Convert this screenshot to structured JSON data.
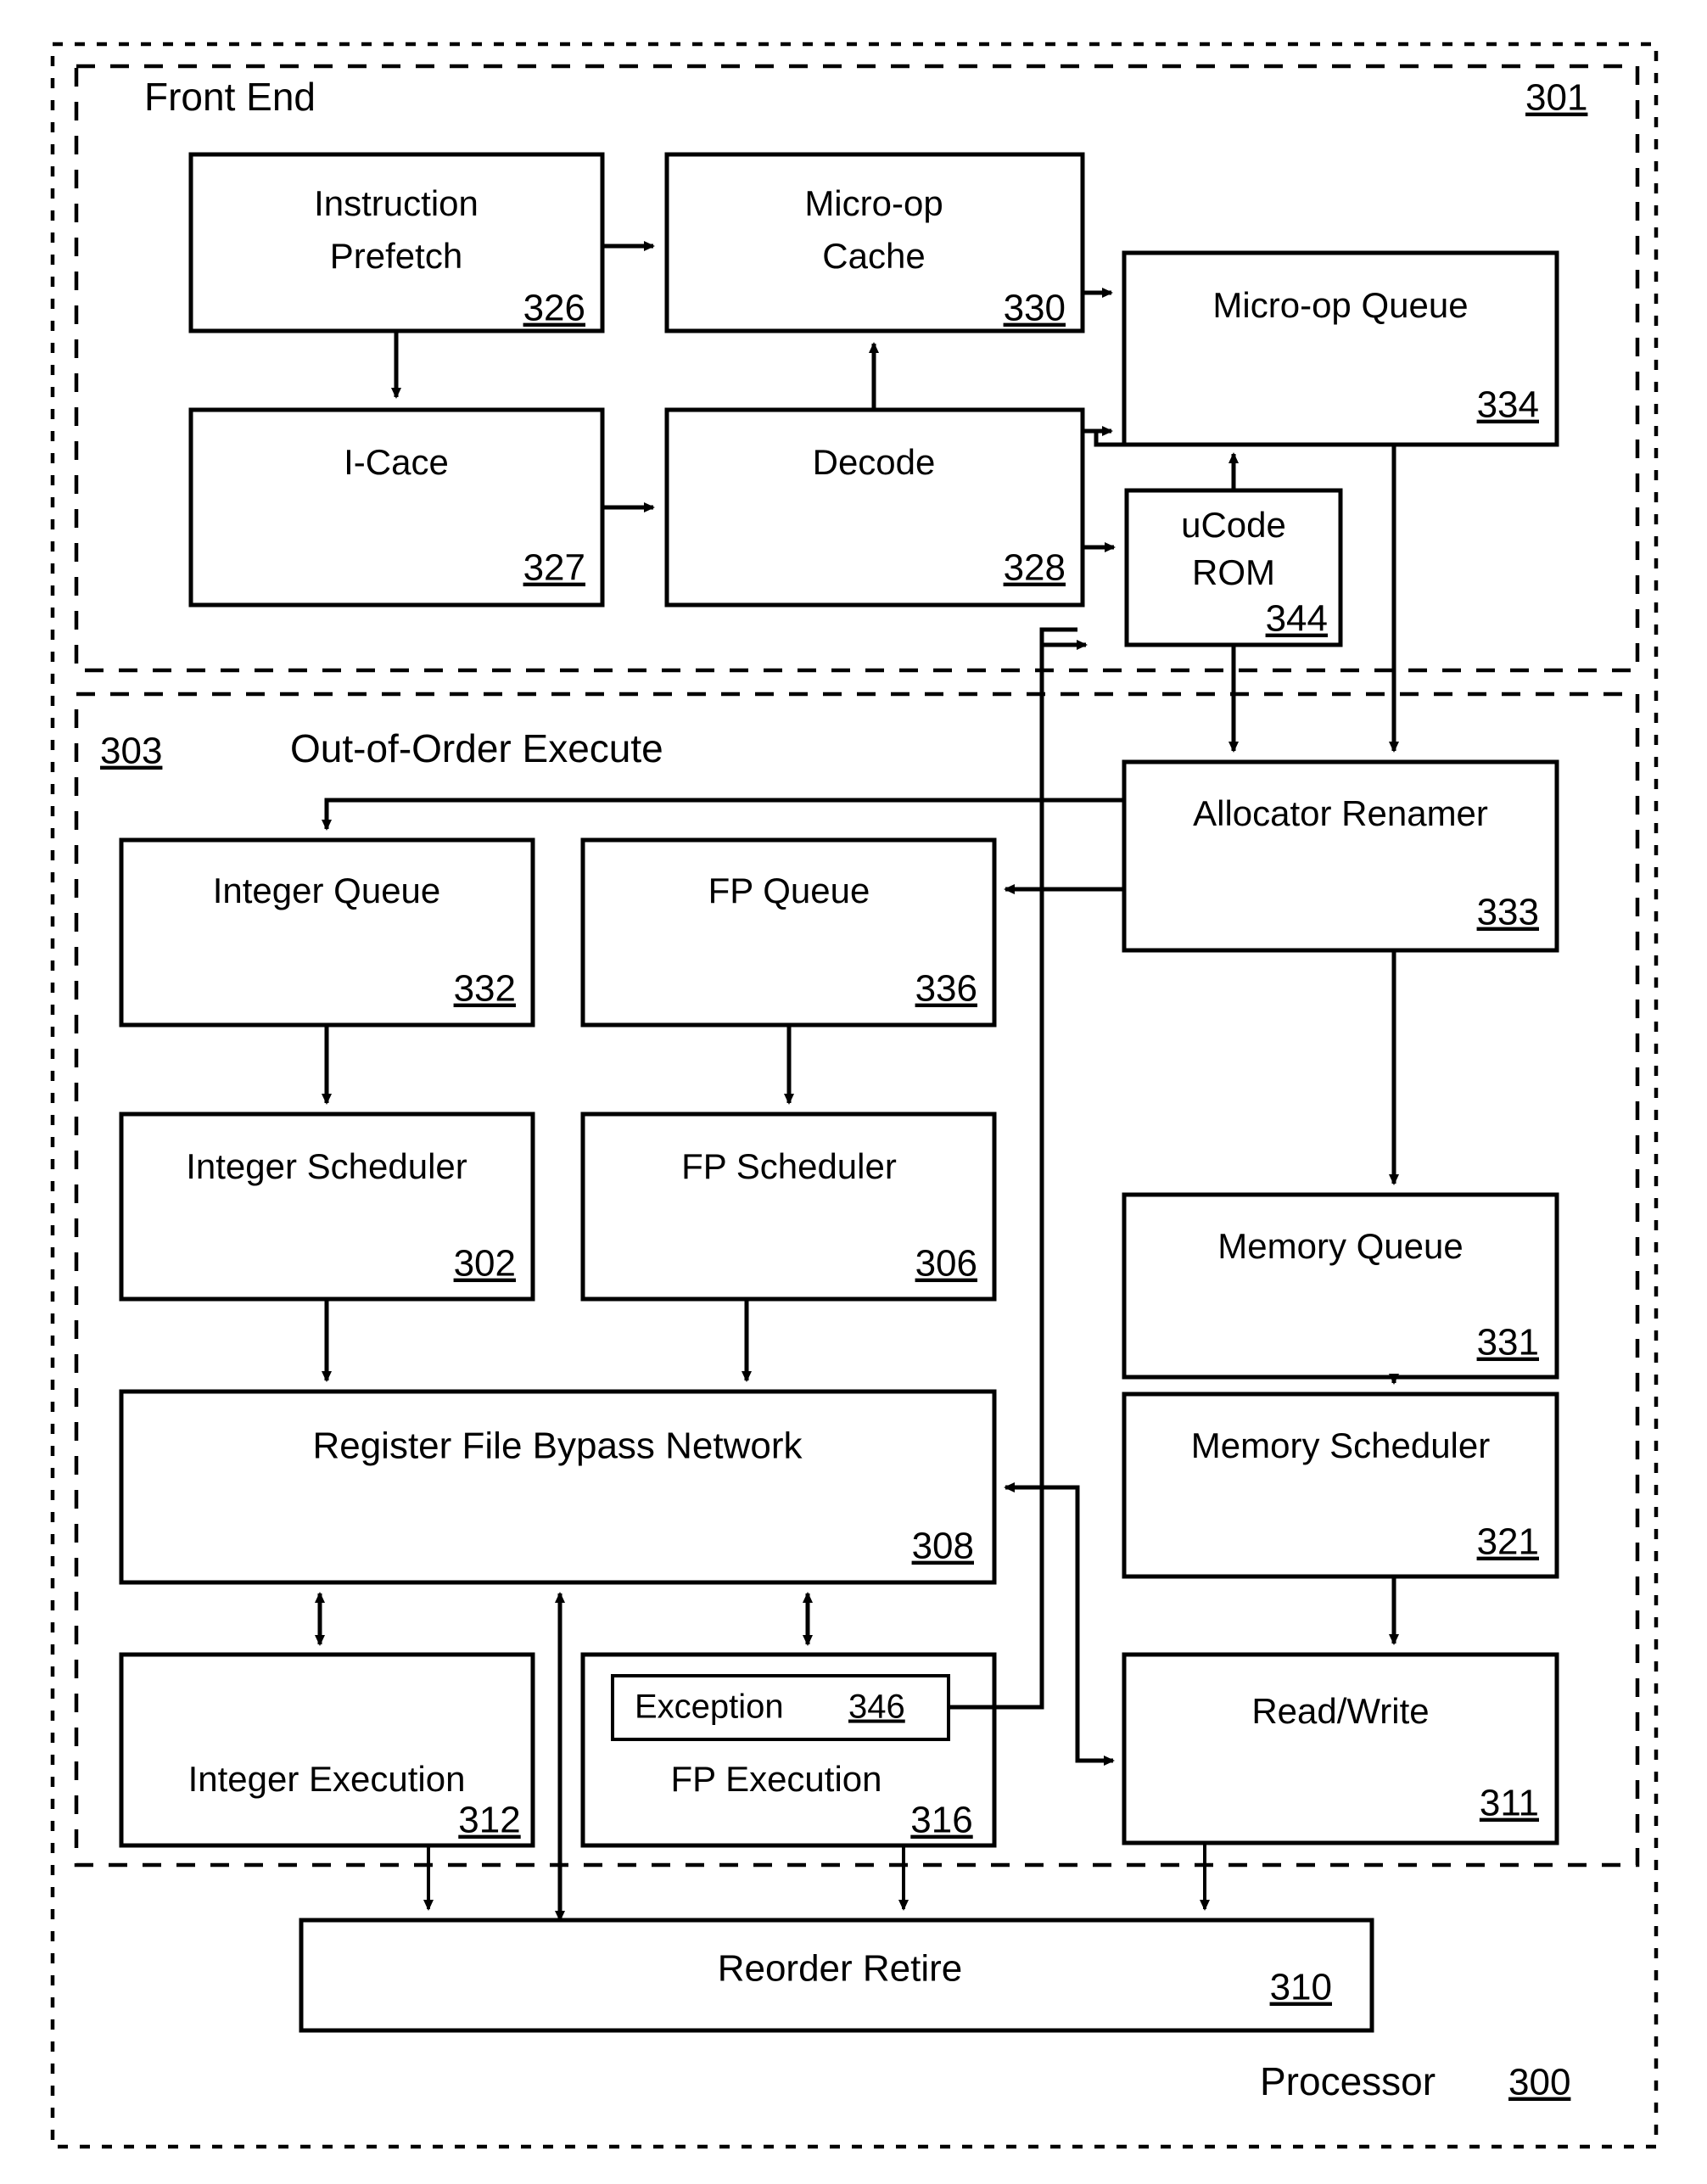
{
  "figure": {
    "processor_label": "Processor",
    "processor_ref": "300",
    "groups": [
      {
        "name": "front-end",
        "title": "Front End",
        "ref": "301"
      },
      {
        "name": "out-of-order-execute",
        "title": "Out-of-Order Execute",
        "ref": "303"
      }
    ]
  },
  "blocks": {
    "instruction_prefetch": {
      "line1": "Instruction",
      "line2": "Prefetch",
      "ref": "326"
    },
    "micro_op_cache": {
      "line1": "Micro-op",
      "line2": "Cache",
      "ref": "330"
    },
    "micro_op_queue": {
      "line1": "Micro-op Queue",
      "ref": "334"
    },
    "i_cace": {
      "line1": "I-Cace",
      "ref": "327"
    },
    "decode": {
      "line1": "Decode",
      "ref": "328"
    },
    "ucode_rom": {
      "line1": "uCode",
      "line2": "ROM",
      "ref": "344"
    },
    "allocator_renamer": {
      "line1": "Allocator Renamer",
      "ref": "333"
    },
    "integer_queue": {
      "line1": "Integer Queue",
      "ref": "332"
    },
    "fp_queue": {
      "line1": "FP Queue",
      "ref": "336"
    },
    "integer_scheduler": {
      "line1": "Integer Scheduler",
      "ref": "302"
    },
    "fp_scheduler": {
      "line1": "FP Scheduler",
      "ref": "306"
    },
    "memory_queue": {
      "line1": "Memory Queue",
      "ref": "331"
    },
    "memory_scheduler": {
      "line1": "Memory Scheduler",
      "ref": "321"
    },
    "register_file_bypass": {
      "line1": "Register File Bypass Network",
      "ref": "308"
    },
    "integer_execution": {
      "line1": "Integer Execution",
      "ref": "312"
    },
    "fp_execution": {
      "line1": "FP Execution",
      "ref": "316"
    },
    "exception": {
      "line1": "Exception",
      "ref": "346"
    },
    "read_write": {
      "line1": "Read/Write",
      "ref": "311"
    },
    "reorder_retire": {
      "line1": "Reorder Retire",
      "ref": "310"
    }
  }
}
